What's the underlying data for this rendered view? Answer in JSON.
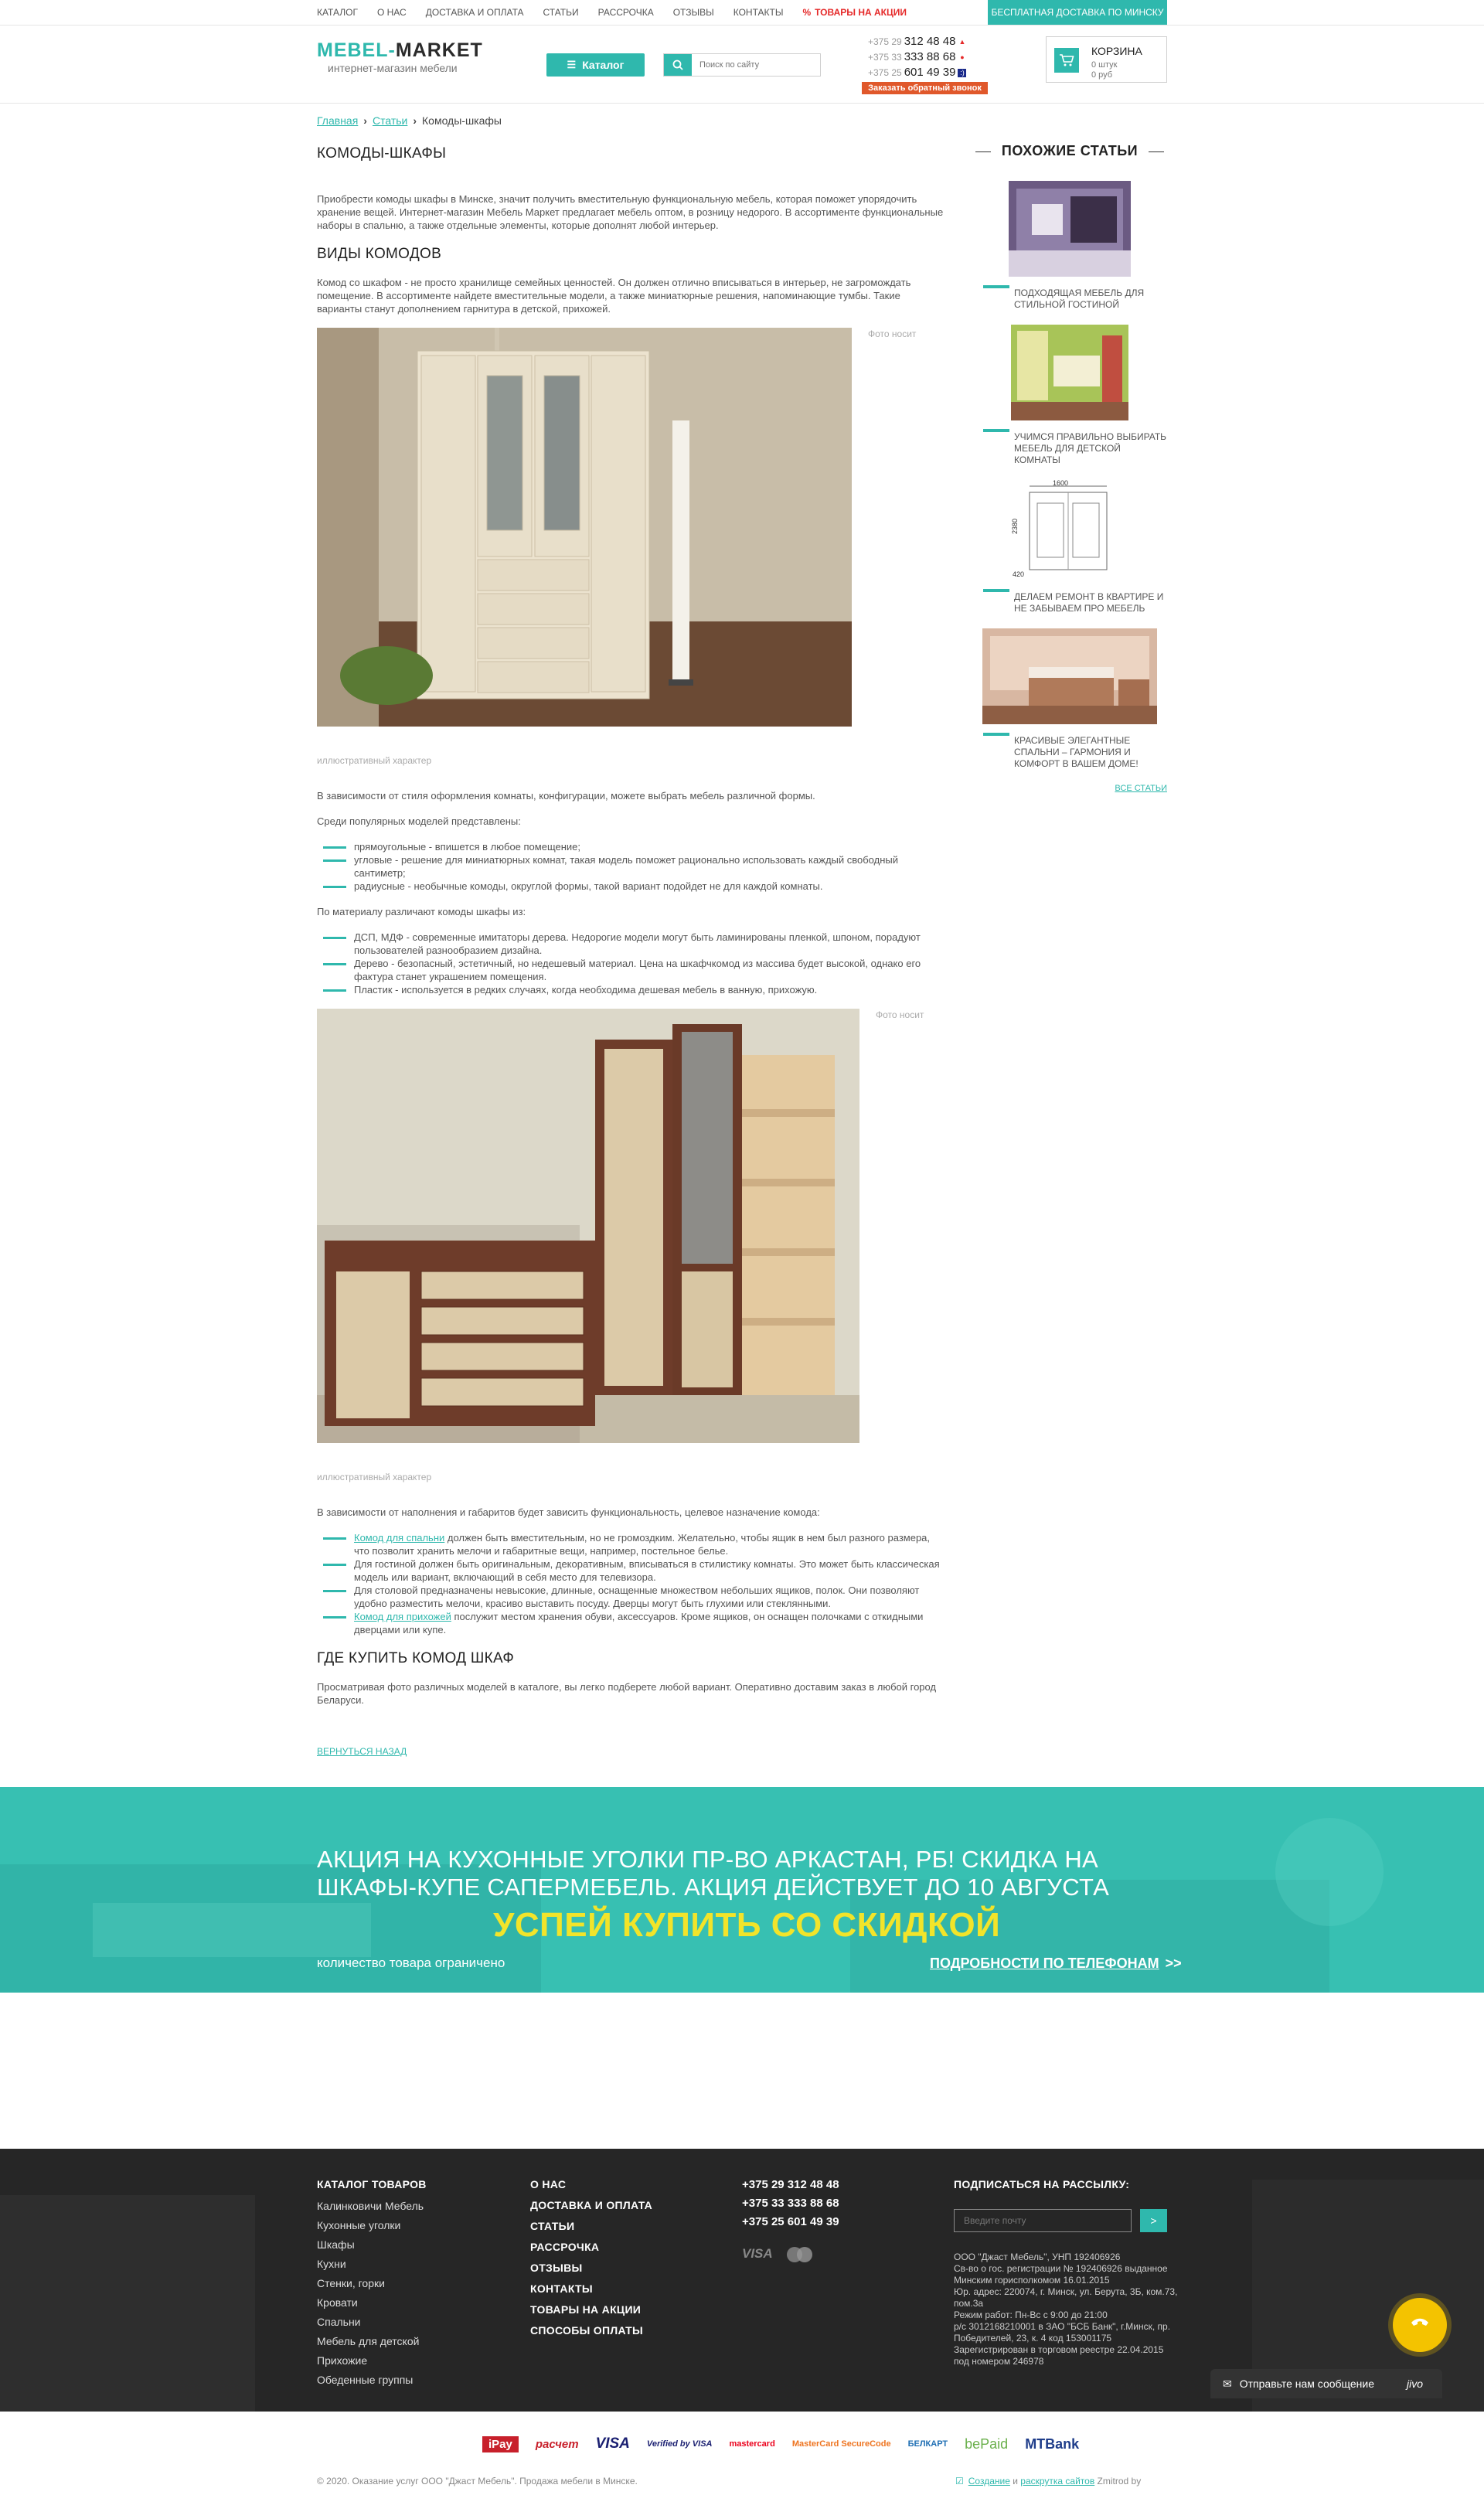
{
  "topnav": {
    "links": [
      "КАТАЛОГ",
      "О НАС",
      "ДОСТАВКА И ОПЛАТА",
      "СТАТЬИ",
      "РАССРОЧКА",
      "ОТЗЫВЫ",
      "КОНТАКТЫ"
    ],
    "promo": "ТОВАРЫ НА АКЦИИ",
    "delivery": "БЕСПЛАТНАЯ ДОСТАВКА ПО МИНСКУ"
  },
  "header": {
    "logo_a": "MEBEL-",
    "logo_b": "MARKET",
    "tagline": "интернет-магазин мебели",
    "catalog_btn": "Каталог",
    "search_placeholder": "Поиск по сайту",
    "phones": [
      {
        "code": "+375 29",
        "number": "312 48 48",
        "op_color": "#e52929",
        "op_icon": "mts-icon",
        "op_glyph": "A1"
      },
      {
        "code": "+375 33",
        "number": "333 88 68",
        "op_color": "#e52929",
        "op_icon": "mts-egg-icon",
        "op_glyph": ""
      },
      {
        "code": "+375 25",
        "number": "601 49 39",
        "op_color": "#1a2a8a",
        "op_icon": "life-icon",
        "op_glyph": ":)"
      }
    ],
    "callback": "Заказать обратный звонок",
    "cart": {
      "title": "КОРЗИНА",
      "qty": "0 штук",
      "sum": "0 руб"
    }
  },
  "breadcrumb": {
    "home": "Главная",
    "articles": "Статьи",
    "current": "Комоды-шкафы"
  },
  "article": {
    "title": "КОМОДЫ-ШКАФЫ",
    "intro": "Приобрести комоды шкафы в Минске, значит получить вместительную функциональную мебель, которая поможет упорядочить хранение вещей. Интернет-магазин Мебель Маркет предлагает мебель оптом, в розницу недорого. В ассортименте функциональные наборы в спальню, а также отдельные элементы, которые дополнят любой интерьер.",
    "h_types": "ВИДЫ КОМОДОВ",
    "types_text": "Комод со шкафом - не просто хранилище семейных ценностей. Он должен отлично вписываться в интерьер, не загромождать помещение. В ассортименте найдете вместительные модели, а также миниатюрные решения, напоминающие тумбы. Такие варианты станут дополнением гарнитура в детской, прихожей.",
    "photo_note": "Фото носит",
    "caption": "иллюстративный характер",
    "style_text": "В зависимости от стиля оформления комнаты, конфигурации, можете выбрать мебель различной формы.",
    "popular_text": "Среди популярных моделей представлены:",
    "shapes": [
      "прямоугольные - впишется в любое помещение;",
      "угловые - решение для миниатюрных комнат, такая модель поможет рационально использовать каждый свободный сантиметр;",
      "радиусные - необычные комоды, округлой формы, такой вариант подойдет не для каждой комнаты."
    ],
    "material_text": "По материалу различают комоды шкафы из:",
    "materials": [
      "ДСП, МДФ - современные имитаторы дерева. Недорогие модели могут быть ламинированы пленкой, шпоном, порадуют пользователей разнообразием дизайна.",
      "Дерево - безопасный, эстетичный, но недешевый материал. Цена на шкафчкомод из массива будет высокой, однако его фактура станет украшением помещения.",
      "Пластик - используется в редких случаях, когда необходима дешевая мебель в ванную, прихожую."
    ],
    "purpose_text": "В зависимости от наполнения и габаритов будет зависить функциональность, целевое назначение комода:",
    "purposes": [
      {
        "link": "Комод для спальни",
        "text": " должен быть вместительным, но не громоздким. Желательно, чтобы ящик в нем был разного размера, что позволит хранить мелочи и габаритные вещи, например, постельное белье."
      },
      {
        "link": "",
        "text": "Для гостиной должен быть оригинальным, декоративным, вписываться в стилистику комнаты. Это может быть классическая модель или вариант, включающий в себя место для телевизора."
      },
      {
        "link": "",
        "text": "Для столовой предназначены невысокие, длинные, оснащенные множеством небольших ящиков, полок. Они позволяют удобно разместить мелочи, красиво выставить посуду. Дверцы могут быть глухими или стеклянными."
      },
      {
        "link": "Комод для прихожей",
        "text": " послужит местом хранения обуви, аксессуаров. Кроме ящиков, он оснащен полочками с откидными дверцами или купе."
      }
    ],
    "h_buy": "ГДЕ КУПИТЬ КОМОД ШКАФ",
    "buy_text": "Просматривая фото различных моделей в каталоге, вы легко подберете любой вариант. Оперативно доставим заказ в любой город Беларуси.",
    "back": "ВЕРНУТЬСЯ НАЗАД"
  },
  "sidebar": {
    "title": "ПОХОЖИЕ СТАТЬИ",
    "items": [
      {
        "title": "ПОДХОДЯЩАЯ МЕБЕЛЬ ДЛЯ СТИЛЬНОЙ ГОСТИНОЙ"
      },
      {
        "title": "УЧИМСЯ ПРАВИЛЬНО ВЫБИРАТЬ МЕБЕЛЬ ДЛЯ ДЕТСКОЙ КОМНАТЫ"
      },
      {
        "title": "ДЕЛАЕМ РЕМОНТ В КВАРТИРЕ И НЕ ЗАБЫВАЕМ ПРО МЕБЕЛЬ"
      },
      {
        "title": "КРАСИВЫЕ ЭЛЕГАНТНЫЕ СПАЛЬНИ – ГАРМОНИЯ И КОМФОРТ В ВАШЕМ ДОМЕ!"
      }
    ],
    "all": "ВСЕ СТАТЬИ",
    "drawing_dims": [
      "1600",
      "2380",
      "420"
    ]
  },
  "banner": {
    "title": "АКЦИЯ НА КУХОННЫЕ УГОЛКИ ПР-ВО АРКАСТАН, РБ! СКИДКА НА ШКАФЫ-КУПЕ САПЕРМЕБЕЛЬ. АКЦИЯ ДЕЙСТВУЕТ ДО 10 АВГУСТА",
    "cta": "УСПЕЙ КУПИТЬ СО СКИДКОЙ",
    "limited": "количество товара ограничено",
    "details": "ПОДРОБНОСТИ ПО ТЕЛЕФОНАМ",
    "details_arrow": ">>"
  },
  "footer": {
    "catalog_title": "КАТАЛОГ ТОВАРОВ",
    "catalog": [
      "Калинковичи Мебель",
      "Кухонные уголки",
      "Шкафы",
      "Кухни",
      "Стенки, горки",
      "Кровати",
      "Спальни",
      "Мебель для детской",
      "Прихожие",
      "Обеденные группы"
    ],
    "menu": [
      "О НАС",
      "ДОСТАВКА И ОПЛАТА",
      "СТАТЬИ",
      "РАССРОЧКА",
      "ОТЗЫВЫ",
      "КОНТАКТЫ",
      "ТОВАРЫ НА АКЦИИ",
      "СПОСОБЫ ОПЛАТЫ"
    ],
    "phones": [
      "+375 29 312 48 48",
      "+375 33 333 88 68",
      "+375 25 601 49 39"
    ],
    "pay_visa": "VISA",
    "subscribe_title": "ПОДПИСАТЬСЯ НА РАССЫЛКУ:",
    "subscribe_placeholder": "Введите почту",
    "subscribe_btn": ">",
    "company": [
      "ООО \"Джаст Мебель\", УНП 192406926",
      "Св-во о гос. регистрации № 192406926 выданное Минским горисполкомом 16.01.2015",
      "Юр. адрес: 220074, г. Минск, ул. Берута, 3Б, ком.73, пом.3а",
      "Режим работ: Пн-Вс с 9:00 до 21:00",
      "р/с 3012168210001 в ЗАО \"БСБ Банк\", г.Минск, пр. Победителей, 23, к. 4 код 153001175",
      "Зарегистрирован в торговом реестре 22.04.2015 под номером 246978"
    ]
  },
  "floating": {
    "chat": "Отправьте нам сообщение",
    "chat_brand": "jivo"
  },
  "payments": [
    "iPay",
    "расчет",
    "VISA",
    "Verified by VISA",
    "mastercard",
    "MasterCard SecureCode",
    "БЕЛКАРТ",
    "bePaid",
    "MTBank"
  ],
  "bottom": {
    "copyright": "© 2020. Оказание услуг ООО \"Джаст Мебель\". Продажа мебели в Минске.",
    "create": "Создание",
    "and": " и ",
    "promo": "раскрутка сайтов",
    "studio": " Zmitrod by"
  },
  "colors": {
    "accent": "#2fb8ad",
    "promo_red": "#e52929",
    "callback": "#e0582b",
    "cta_yellow": "#f2e42a",
    "footer_bg": "#262626"
  }
}
